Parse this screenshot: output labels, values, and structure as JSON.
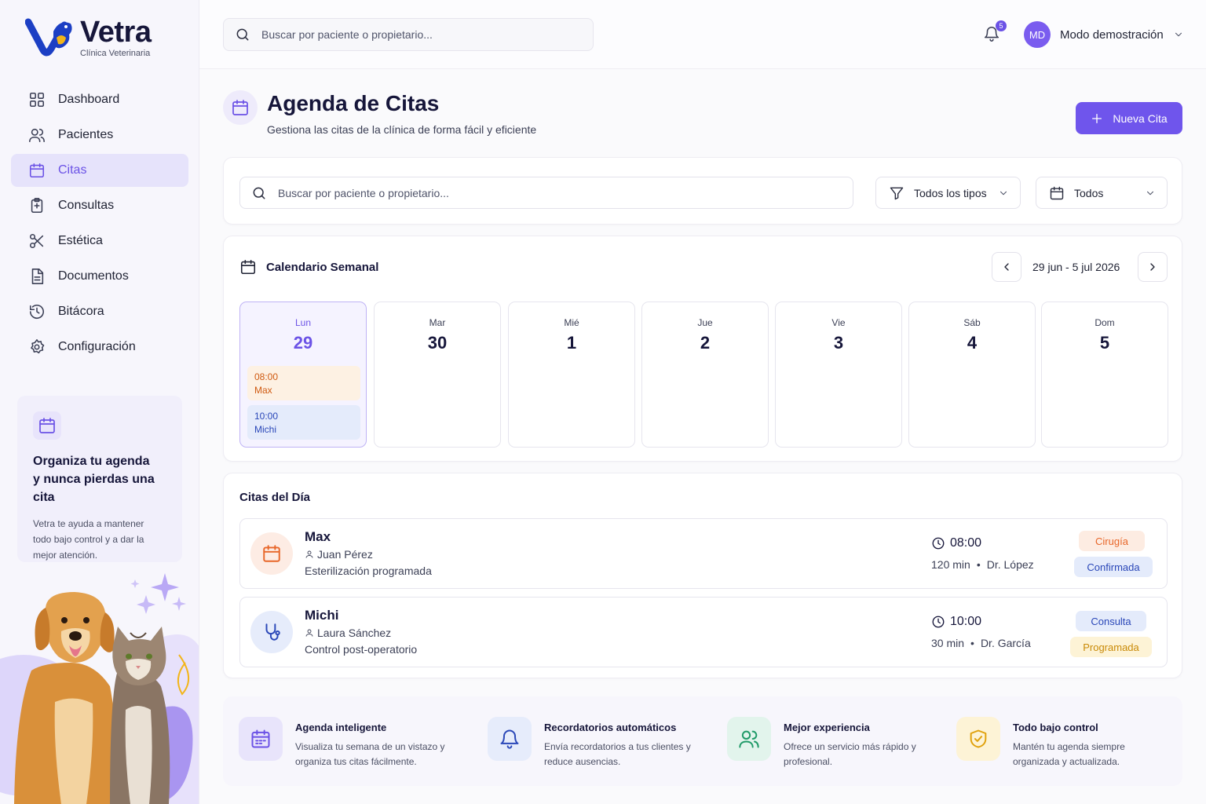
{
  "brand": {
    "name": "Vetra",
    "subtitle": "Clínica Veterinaria"
  },
  "sidebar": {
    "items": [
      {
        "label": "Dashboard",
        "icon": "grid-icon"
      },
      {
        "label": "Pacientes",
        "icon": "users-icon"
      },
      {
        "label": "Citas",
        "icon": "calendar-icon",
        "active": true
      },
      {
        "label": "Consultas",
        "icon": "clipboard-icon"
      },
      {
        "label": "Estética",
        "icon": "scissors-icon"
      },
      {
        "label": "Documentos",
        "icon": "document-icon"
      },
      {
        "label": "Bitácora",
        "icon": "history-icon"
      },
      {
        "label": "Configuración",
        "icon": "gear-icon"
      }
    ],
    "promo": {
      "title": "Organiza tu agenda y nunca pierdas una cita",
      "text": "Vetra te ayuda a mantener todo bajo control y a dar la mejor atención."
    }
  },
  "topbar": {
    "search_placeholder": "Buscar por paciente o propietario...",
    "notifications_count": "5",
    "user_initials": "MD",
    "user_name": "Modo demostración"
  },
  "header": {
    "title": "Agenda de Citas",
    "subtitle": "Gestiona las citas de la clínica de forma fácil y eficiente",
    "new_button": "Nueva Cita"
  },
  "filters": {
    "search_placeholder": "Buscar por paciente o propietario...",
    "type_select": "Todos los tipos",
    "date_select": "Todos"
  },
  "calendar": {
    "title": "Calendario Semanal",
    "range": "29 jun - 5 jul 2026",
    "days": [
      {
        "name": "Lun",
        "num": "29",
        "active": true
      },
      {
        "name": "Mar",
        "num": "30"
      },
      {
        "name": "Mié",
        "num": "1"
      },
      {
        "name": "Jue",
        "num": "2"
      },
      {
        "name": "Vie",
        "num": "3"
      },
      {
        "name": "Sáb",
        "num": "4"
      },
      {
        "name": "Dom",
        "num": "5"
      }
    ],
    "slots": [
      {
        "time": "08:00",
        "pet": "Max"
      },
      {
        "time": "10:00",
        "pet": "Michi"
      }
    ]
  },
  "today": {
    "title": "Citas del Día",
    "appointments": [
      {
        "pet": "Max",
        "owner": "Juan Pérez",
        "description": "Esterilización programada",
        "time": "08:00",
        "duration": "120 min",
        "doctor": "Dr. López",
        "type": "Cirugía",
        "status": "Confirmada",
        "icon": "calendar-icon"
      },
      {
        "pet": "Michi",
        "owner": "Laura Sánchez",
        "description": "Control post-operatorio",
        "time": "10:00",
        "duration": "30 min",
        "doctor": "Dr. García",
        "type": "Consulta",
        "status": "Programada",
        "icon": "stethoscope-icon"
      }
    ]
  },
  "features": [
    {
      "title": "Agenda inteligente",
      "text": "Visualiza tu semana de un vistazo y organiza tus citas fácilmente.",
      "icon": "calendar-icon"
    },
    {
      "title": "Recordatorios automáticos",
      "text": "Envía recordatorios a tus clientes y reduce ausencias.",
      "icon": "bell-icon"
    },
    {
      "title": "Mejor experiencia",
      "text": "Ofrece un servicio más rápido y profesional.",
      "icon": "users-icon"
    },
    {
      "title": "Todo bajo control",
      "text": "Mantén tu agenda siempre organizada y actualizada.",
      "icon": "shield-check-icon"
    }
  ],
  "colors": {
    "accent": "#6b52e6",
    "orange": "#cf5a11",
    "blue": "#2a47b8",
    "yellow": "#c98a07",
    "green": "#1f9a68"
  }
}
